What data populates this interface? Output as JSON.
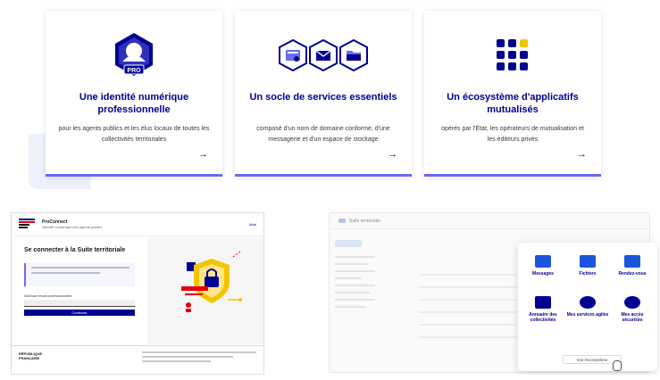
{
  "cards": [
    {
      "title": "Une identité numérique professionnelle",
      "text": "pour les agents publics et les élus locaux de toutes les collectivités territoriales",
      "badge": "PRO",
      "icon": "identity-pro-badge-icon"
    },
    {
      "title": "Un socle de services essentiels",
      "text": "composé d'un nom de domaine conforme, d'une messagerie et d'un espace de stockage",
      "icon": "services-hexagons-icon"
    },
    {
      "title": "Un écosystème d'applicatifs mutualisés",
      "text": "opérés par l'État, les opérateurs de mutualisation et les éditeurs privés",
      "icon": "apps-grid-icon"
    }
  ],
  "arrow_glyph": "→",
  "login_mock": {
    "brand": "ProConnect",
    "subtitle": "Identité numérique des agents publics",
    "header_link": "Aide",
    "heading": "Se connecter à la Suite territoriale",
    "email_label": "Adresse email professionnelle",
    "button_label": "Continuer",
    "footer_brand": "RÉPUBLIQUE FRANÇAISE"
  },
  "suite_mock": {
    "window_title": "Suite territoriale",
    "apps": [
      {
        "label": "Messages",
        "color": "#1a56db"
      },
      {
        "label": "Fichiers",
        "color": "#1a56db"
      },
      {
        "label": "Rendez-vous",
        "color": "#1a56db"
      },
      {
        "label": "Annuaire des collectivités",
        "color": "#000091"
      },
      {
        "label": "Mes services agiles",
        "color": "#000091"
      },
      {
        "label": "Mes accès sécurisés",
        "color": "#000091"
      }
    ],
    "more_label": "Voir l'écosystème"
  },
  "colors": {
    "accent": "#000091",
    "accent_light": "#6a6af4",
    "yellow": "#f5c400"
  }
}
